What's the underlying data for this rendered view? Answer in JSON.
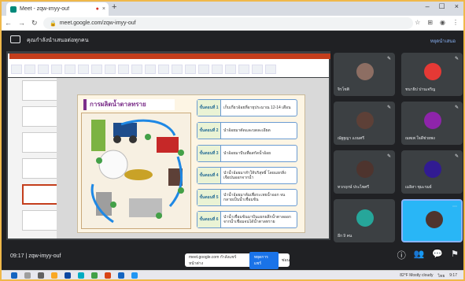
{
  "browser": {
    "tab_title": "Meet - zqw-imyy-ouf",
    "tab_close": "×",
    "new_tab": "+",
    "url": "meet.google.com/zqw-imyy-ouf",
    "nav": [
      "←",
      "→",
      "↻"
    ],
    "window_controls": [
      "–",
      "☐",
      "×"
    ]
  },
  "meet_header": {
    "title": "คุณกำลังนำเสนอต่อทุกคน",
    "you_label": "หยุดนำเสนอ"
  },
  "slide": {
    "title": "การผลิตน้ำตาลทราย",
    "steps": [
      {
        "label": "ขั้นตอนที่ 1",
        "text": "เก็บเกี่ยวอ้อยที่อายุประมาณ 12-14 เดือน"
      },
      {
        "label": "ขั้นตอนที่ 2",
        "text": "นำอ้อยมาตัดและบดละเอียด"
      },
      {
        "label": "ขั้นตอนที่ 3",
        "text": "นำอ้อยมาบีบเพื่อสกัดน้ำอ้อย"
      },
      {
        "label": "ขั้นตอนที่ 4",
        "text": "นำน้ำอ้อยมาทำให้บริสุทธิ์ โดยแยกสิ่งเจือปนออกจากน้ำ"
      },
      {
        "label": "ขั้นตอนที่ 5",
        "text": "นำน้ำอ้อยมาต้มเพื่อระเหยน้ำออก จนกลายเป็นน้ำเชื่อมข้น"
      },
      {
        "label": "ขั้นตอนที่ 6",
        "text": "นำน้ำเชื่อมข้นมาปั่นแยกผลึกน้ำตาลออกจากน้ำเชื่อมจนได้น้ำตาลทราย"
      }
    ]
  },
  "participants": [
    {
      "name": "จิรโชติ",
      "color": "#8d6e63"
    },
    {
      "name": "ชนาธิป ปานเจริญ",
      "color": "#e53935"
    },
    {
      "name": "ณัฐฐญา แถมศรี",
      "color": "#5d4037"
    },
    {
      "name": "ณพเพ ใจดีช่วยพง",
      "color": "#8e24aa"
    },
    {
      "name": "ทวกฤกษ์ ประไพศรี",
      "color": "#4e342e"
    },
    {
      "name": "เมลิสา ชุมะรมย์",
      "color": "#311b92"
    },
    {
      "name": "อีก 9 คน",
      "color": "#26a69a"
    },
    {
      "name": "",
      "color": "#29b6f6"
    }
  ],
  "bottom": {
    "time": "09:17 | zqw-imyy-ouf",
    "pill_text": "meet.google.com กำลังแชร์หน้าต่าง",
    "stop_label": "หยุดการแชร์",
    "hide_label": "ซ่อน",
    "icons": [
      "info-icon",
      "people-icon",
      "chat-icon",
      "activities-icon"
    ]
  },
  "taskbar": {
    "tray_text": "82°F Mostly cloudy",
    "lang": "ไทย",
    "clock": "9:17"
  }
}
